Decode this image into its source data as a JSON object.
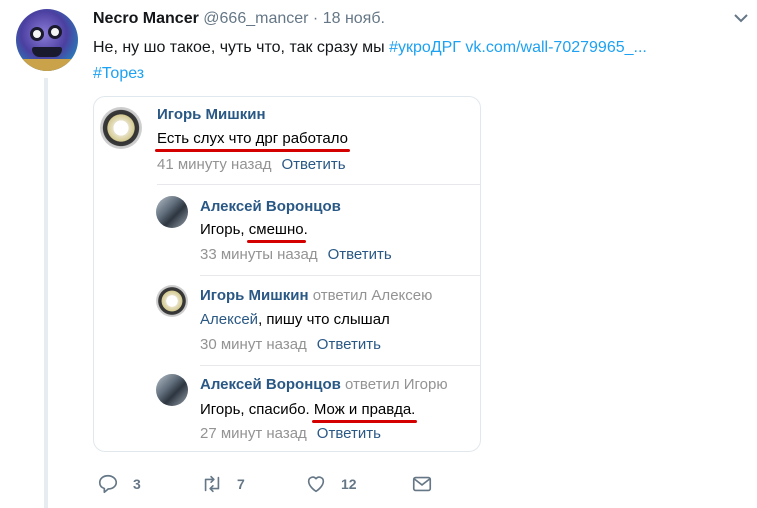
{
  "tweet": {
    "author_name": "Necro Mancer",
    "handle": "@666_mancer",
    "dot": "·",
    "date": "18 нояб.",
    "text_prefix": "Не, ну шо такое, чуть что, так сразу мы ",
    "hashtag1": "#укроДРГ",
    "url": "vk.com/wall-70279965_...",
    "hashtag2": "#Торез"
  },
  "comments": [
    {
      "author": "Игорь Мишкин",
      "replied_to": "",
      "text": "Есть слух что дрг работало",
      "time": "41 минуту назад",
      "reply_label": "Ответить"
    },
    {
      "author": "Алексей Воронцов",
      "replied_to": "",
      "text_before": "Игорь, ",
      "text_underlined": "смешно",
      "text_after": ".",
      "time": "33 минуты назад",
      "reply_label": "Ответить"
    },
    {
      "author": "Игорь Мишкин",
      "replied_to": "ответил Алексею",
      "addressee": "Алексей",
      "text_after": ", пишу что слышал",
      "time": "30 минут назад",
      "reply_label": "Ответить"
    },
    {
      "author": "Алексей Воронцов",
      "replied_to": "ответил Игорю",
      "text_before": "Игорь, спасибо. ",
      "text_underlined": "Мож и правда.",
      "time": "27 минут назад",
      "reply_label": "Ответить"
    }
  ],
  "actions": {
    "replies": "3",
    "retweets": "7",
    "likes": "12",
    "colors": {
      "icon": "#657786",
      "link": "#1da1f2",
      "vk_link": "#2a5885",
      "underline": "#d40000"
    }
  }
}
